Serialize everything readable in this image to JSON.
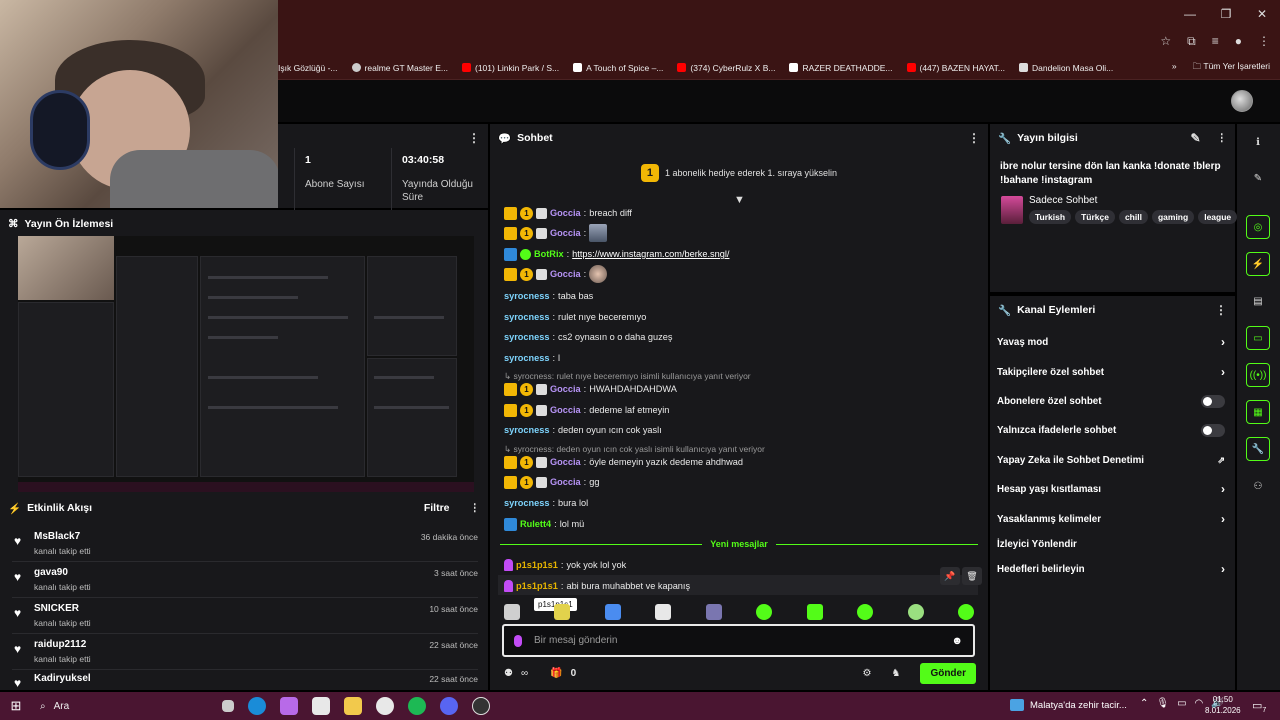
{
  "bookmarks": [
    {
      "label": "Işık Gözlüğü -...",
      "color": "#3a1414"
    },
    {
      "label": "realme GT Master E...",
      "color": "#cccccc"
    },
    {
      "label": "(101) Linkin Park / S...",
      "color": "#ff0000"
    },
    {
      "label": "A Touch of Spice –...",
      "color": "#ffffff"
    },
    {
      "label": "(374) CyberRulz X B...",
      "color": "#ff0000"
    },
    {
      "label": "RAZER DEATHADDE...",
      "color": "#ffffff"
    },
    {
      "label": "(447) BAZEN HAYAT...",
      "color": "#ff0000"
    },
    {
      "label": "Dandelion Masa Oli...",
      "color": "#dddddd"
    }
  ],
  "bookmarks_right": {
    "more": "»",
    "all": "Tüm Yer İşaretleri"
  },
  "stats": {
    "items": [
      {
        "value": "1",
        "label": "Abone Sayısı"
      },
      {
        "value": "03:40:58",
        "label": "Yayında Olduğu Süre"
      }
    ]
  },
  "preview": {
    "title": "Yayın Ön İzlemesi"
  },
  "activity": {
    "title": "Etkinlik Akışı",
    "filter": "Filtre",
    "items": [
      {
        "name": "MsBlack7",
        "sub": "kanalı takip etti",
        "time": "36 dakika önce"
      },
      {
        "name": "gava90",
        "sub": "kanalı takip etti",
        "time": "3 saat önce"
      },
      {
        "name": "SNICKER",
        "sub": "kanalı takip etti",
        "time": "10 saat önce"
      },
      {
        "name": "raidup2112",
        "sub": "kanalı takip etti",
        "time": "22 saat önce"
      },
      {
        "name": "Kadiryuksel",
        "sub": "",
        "time": "22 saat önce"
      }
    ]
  },
  "chat": {
    "title": "Sohbet",
    "sub_banner": {
      "rank": "1",
      "text": "1 abonelik hediye ederek 1. sıraya yükselin"
    },
    "messages": [
      {
        "user": "Goccia",
        "text": "breach diff"
      },
      {
        "user": "Goccia",
        "text": ""
      },
      {
        "user": "BotRix",
        "text": "https://www.instagram.com/berke.sngl/"
      },
      {
        "user": "Goccia",
        "text": ""
      },
      {
        "user": "syrocness",
        "text": "taba bas"
      },
      {
        "user": "syrocness",
        "text": "rulet nıye beceremıyo"
      },
      {
        "user": "syrocness",
        "text": "cs2 oynasın o o daha guzeş"
      },
      {
        "user": "syrocness",
        "text": "l"
      },
      {
        "user": "Goccia",
        "text": "HWAHDAHDAHDWA"
      },
      {
        "user": "Goccia",
        "text": "dedeme laf etmeyin"
      },
      {
        "user": "syrocness",
        "text": "deden oyun ıcın cok yaslı"
      },
      {
        "user": "Goccia",
        "text": "öyle demeyin yazık dedeme ahdhwad"
      },
      {
        "user": "Goccia",
        "text": "gg"
      },
      {
        "user": "syrocness",
        "text": "bura lol"
      },
      {
        "user": "Rulett4",
        "text": "lol mü"
      },
      {
        "user": "p1s1p1s1",
        "text": "yok yok lol yok"
      },
      {
        "user": "p1s1p1s1",
        "text": "abi bura muhabbet ve kapanış"
      }
    ],
    "replies": [
      "syrocness: rulet nıye beceremıyo isimli kullanıcıya yanıt veriyor",
      "syrocness: deden oyun ıcın cok yaslı isimli kullanıcıya yanıt veriyor"
    ],
    "new_messages": "Yeni mesajlar",
    "tooltip": "p1s1p1s1",
    "input_placeholder": "Bir mesaj gönderin",
    "footer": {
      "points": "∞",
      "count": "0",
      "send": "Gönder"
    }
  },
  "stream_info": {
    "title": "Yayın bilgisi",
    "stream_title": "ibre nolur tersine dön lan kanka !donate !blerp !bahane !instagram",
    "category": "Sadece Sohbet",
    "tags": [
      "Turkish",
      "Türkçe",
      "chill",
      "gaming",
      "league"
    ]
  },
  "channel_actions": {
    "title": "Kanal Eylemleri",
    "items": [
      {
        "label": "Yavaş mod",
        "control": "chevron"
      },
      {
        "label": "Takipçilere özel sohbet",
        "control": "chevron"
      },
      {
        "label": "Abonelere özel sohbet",
        "control": "toggle"
      },
      {
        "label": "Yalnızca ifadelerle sohbet",
        "control": "toggle"
      },
      {
        "label": "Yapay Zeka ile Sohbet Denetimi",
        "control": "external"
      },
      {
        "label": "Hesap yaşı kısıtlaması",
        "control": "chevron"
      },
      {
        "label": "Yasaklanmış kelimeler",
        "control": "chevron"
      },
      {
        "label": "İzleyici Yönlendir",
        "control": "none"
      },
      {
        "label": "Hedefleri belirleyin",
        "control": "chevron"
      }
    ]
  },
  "taskbar": {
    "search": "Ara",
    "news": "Malatya'da zehir tacir...",
    "time": "01:50",
    "date": "8.01.2026",
    "notif_count": "7"
  },
  "colors": {
    "accent": "#53fc18",
    "panel": "#18181b",
    "chrome": "#3a1414",
    "taskbar": "#4a1531"
  }
}
